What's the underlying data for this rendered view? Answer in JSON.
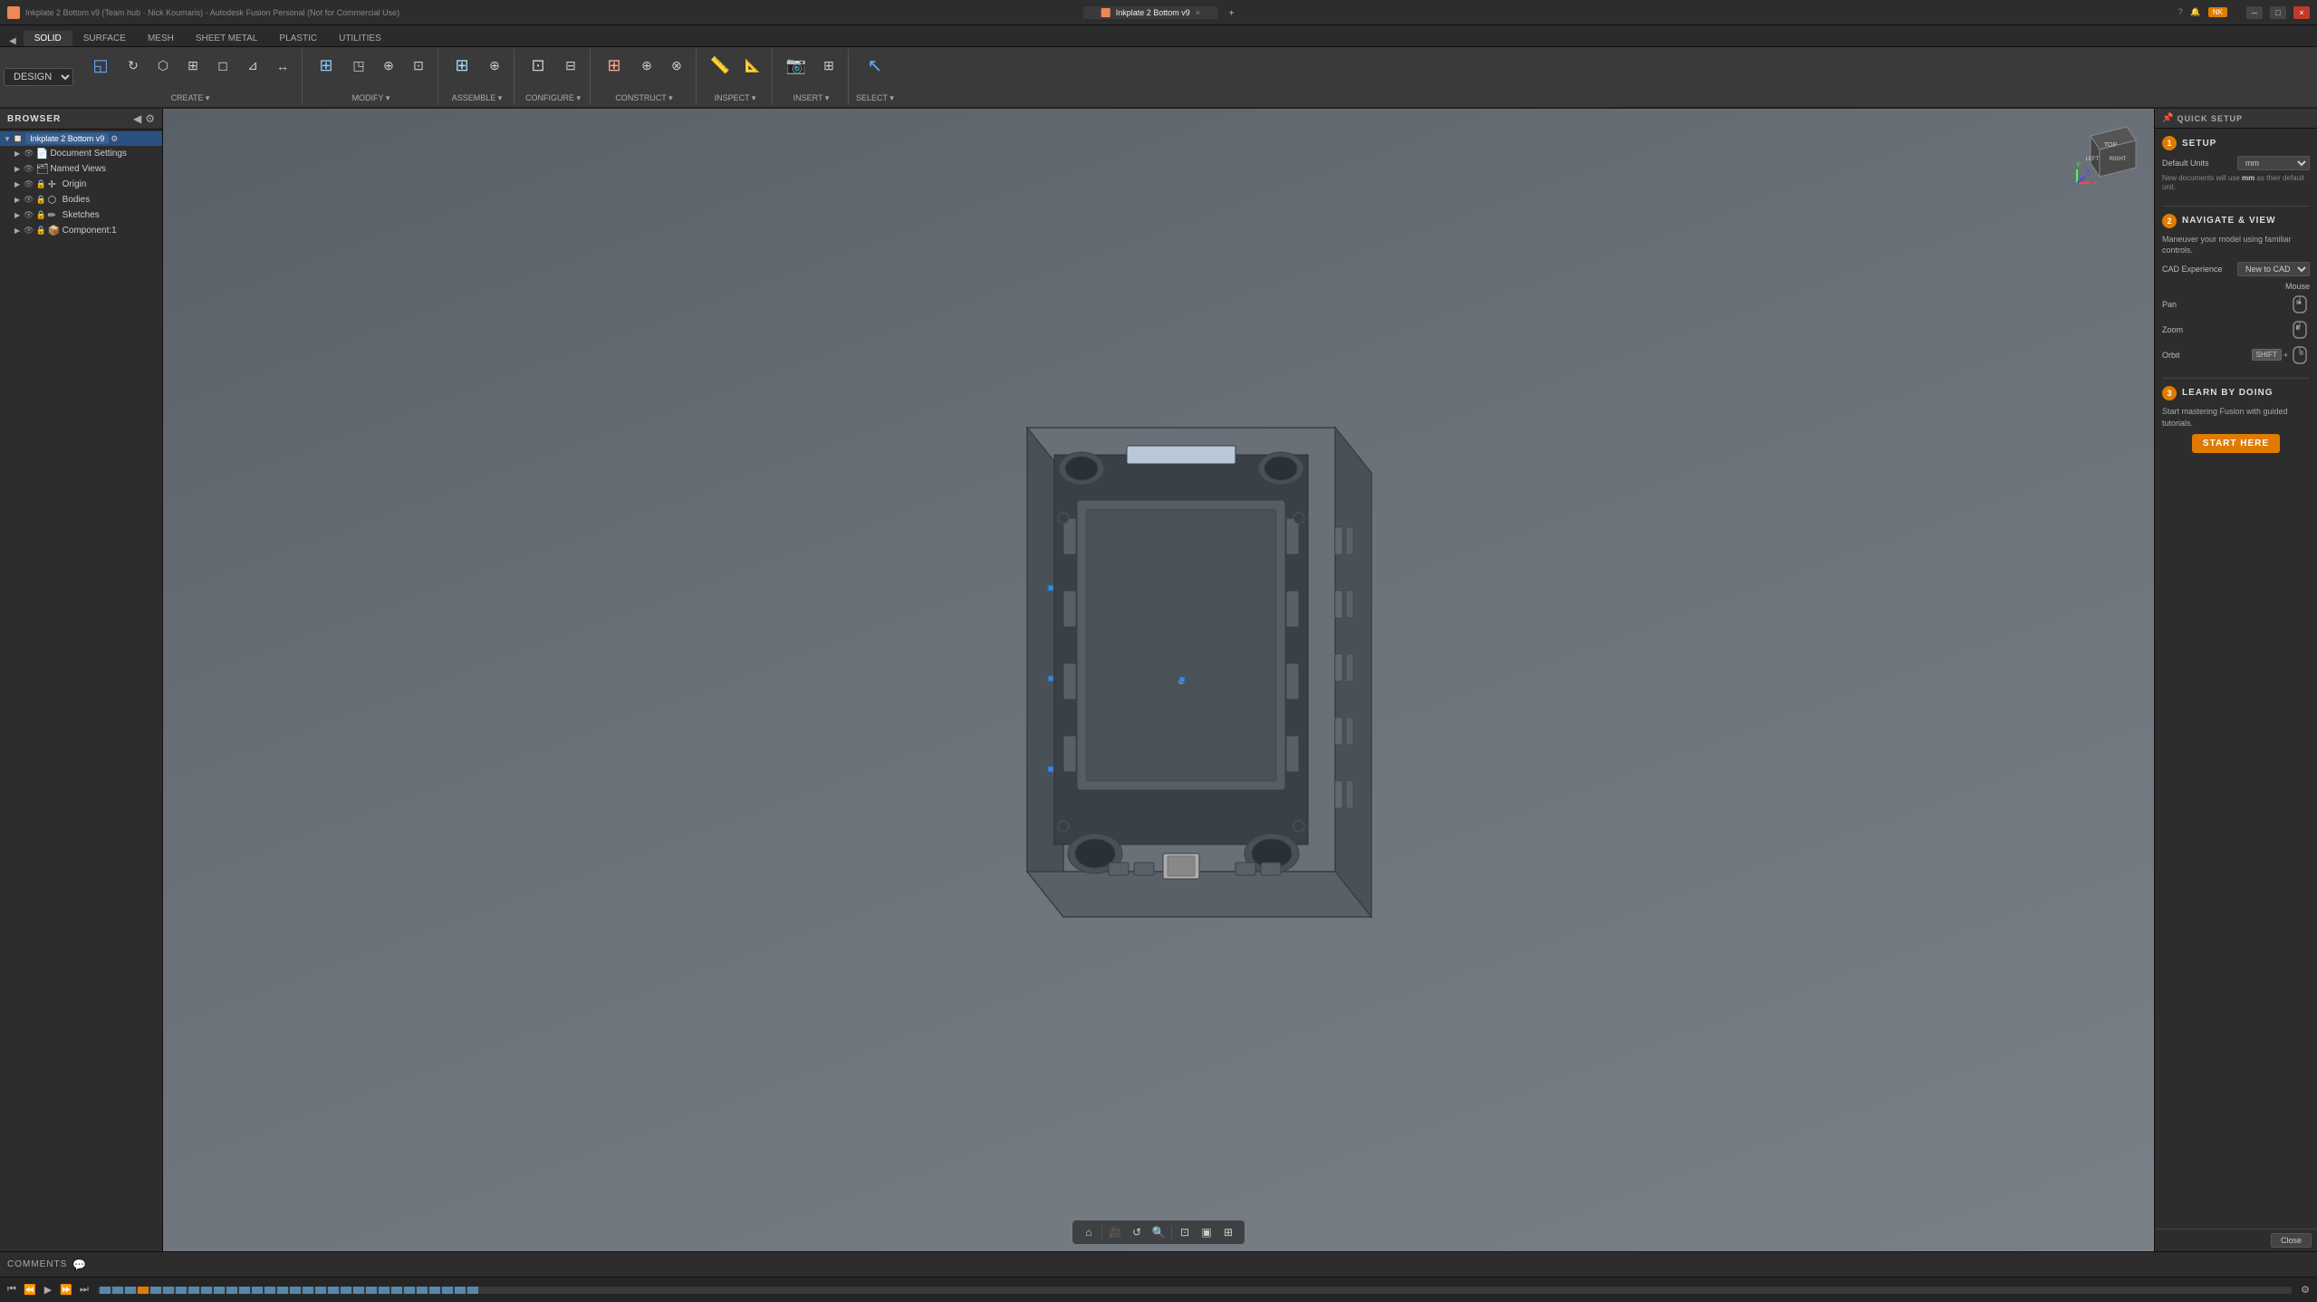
{
  "titlebar": {
    "title": "Inkplate 2 Bottom v9 (Team hub · Nick Koumaris) - Autodesk Fusion Personal (Not for Commercial Use)",
    "tab_title": "Inkplate 2 Bottom v9",
    "close_label": "×",
    "min_label": "─",
    "max_label": "□"
  },
  "toolbar_tabs": {
    "items": [
      {
        "label": "SOLID",
        "active": true
      },
      {
        "label": "SURFACE",
        "active": false
      },
      {
        "label": "MESH",
        "active": false
      },
      {
        "label": "SHEET METAL",
        "active": false
      },
      {
        "label": "PLASTIC",
        "active": false
      },
      {
        "label": "UTILITIES",
        "active": false
      }
    ]
  },
  "ribbon": {
    "design_dropdown": "DESIGN ▾",
    "groups": [
      {
        "label": "CREATE ▾",
        "buttons": [
          {
            "icon": "⬡",
            "label": ""
          },
          {
            "icon": "⊞",
            "label": ""
          },
          {
            "icon": "◱",
            "label": ""
          },
          {
            "icon": "⊕",
            "label": ""
          },
          {
            "icon": "◻",
            "label": ""
          },
          {
            "icon": "⊿",
            "label": ""
          },
          {
            "icon": "↔",
            "label": ""
          }
        ]
      },
      {
        "label": "MODIFY ▾",
        "buttons": [
          {
            "icon": "⬡",
            "label": ""
          },
          {
            "icon": "⊞",
            "label": ""
          },
          {
            "icon": "◳",
            "label": ""
          },
          {
            "icon": "⊕",
            "label": ""
          }
        ]
      },
      {
        "label": "ASSEMBLE ▾",
        "buttons": [
          {
            "icon": "⊞",
            "label": ""
          },
          {
            "icon": "⊕",
            "label": ""
          }
        ]
      },
      {
        "label": "CONFIGURE ▾",
        "buttons": [
          {
            "icon": "⊡",
            "label": ""
          },
          {
            "icon": "⊟",
            "label": ""
          }
        ]
      },
      {
        "label": "CONSTRUCT ▾",
        "buttons": [
          {
            "icon": "⊞",
            "label": ""
          },
          {
            "icon": "⊕",
            "label": ""
          },
          {
            "icon": "⊗",
            "label": ""
          }
        ]
      },
      {
        "label": "INSPECT ▾",
        "buttons": [
          {
            "icon": "🔍",
            "label": ""
          },
          {
            "icon": "📐",
            "label": ""
          }
        ]
      },
      {
        "label": "INSERT ▾",
        "buttons": [
          {
            "icon": "📷",
            "label": ""
          },
          {
            "icon": "⊞",
            "label": ""
          }
        ]
      },
      {
        "label": "SELECT ▾",
        "buttons": [
          {
            "icon": "↖",
            "label": ""
          }
        ]
      }
    ]
  },
  "browser": {
    "title": "BROWSER",
    "items": [
      {
        "label": "Inkplate 2 Bottom v9",
        "depth": 0,
        "hasArrow": true,
        "selected": true
      },
      {
        "label": "Document Settings",
        "depth": 1,
        "hasArrow": false
      },
      {
        "label": "Named Views",
        "depth": 1,
        "hasArrow": false
      },
      {
        "label": "Origin",
        "depth": 1,
        "hasArrow": false
      },
      {
        "label": "Bodies",
        "depth": 1,
        "hasArrow": false
      },
      {
        "label": "Sketches",
        "depth": 1,
        "hasArrow": false
      },
      {
        "label": "Component:1",
        "depth": 1,
        "hasArrow": false
      }
    ]
  },
  "quick_setup": {
    "panel_title": "QUICK SETUP",
    "sections": [
      {
        "num": "1",
        "title": "SETUP",
        "fields": [
          {
            "label": "Default Units",
            "value": "mm"
          }
        ],
        "note": "New documents will use mm as their default unit."
      },
      {
        "num": "2",
        "title": "NAVIGATE & VIEW",
        "desc": "Maneuver your model using familiar controls.",
        "cad_experience_label": "CAD Experience",
        "cad_experience_value": "New to CAD",
        "mouse_label": "Mouse",
        "controls": [
          {
            "label": "Pan",
            "icon": "pan"
          },
          {
            "label": "Zoom",
            "icon": "zoom"
          },
          {
            "label": "Orbit",
            "shift": true,
            "icon": "orbit"
          }
        ]
      },
      {
        "num": "3",
        "title": "LEARN BY DOING",
        "desc": "Start mastering Fusion with guided tutorials.",
        "button_label": "START HERE"
      }
    ],
    "close_label": "Close"
  },
  "comments": {
    "label": "COMMENTS"
  },
  "viewport_bottom": {
    "buttons": [
      "⌂",
      "|",
      "🎥",
      "↺",
      "🔍",
      "|",
      "⊡",
      "▣",
      "⊞"
    ]
  }
}
